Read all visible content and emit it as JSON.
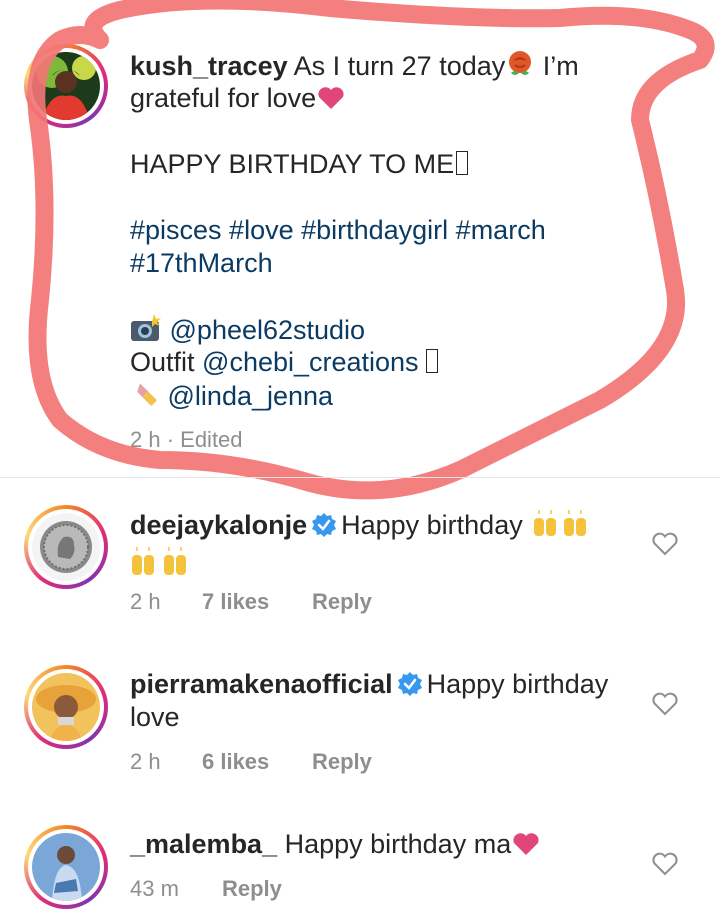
{
  "post": {
    "username": "kush_tracey",
    "caption_line1": " As I turn 27 today",
    "caption_line1_end": " I’m",
    "caption_line2": "grateful for love",
    "birthday_line": "HAPPY BIRTHDAY TO ME",
    "hashtags_line1": "#pisces #love #birthdaygirl #march",
    "hashtags_line2": "#17thMarch",
    "photo_credit": "@pheel62studio",
    "outfit_label": "Outfit ",
    "outfit_credit": "@chebi_creations",
    "makeup_credit": "@linda_jenna",
    "time": "2 h",
    "edited": " · Edited"
  },
  "comments": [
    {
      "username": "deejaykalonje",
      "verified": true,
      "text": "Happy birthday",
      "time": "2 h",
      "likes": "7 likes",
      "reply": "Reply",
      "avatar_icon": "coin-avatar-icon"
    },
    {
      "username": "pierramakenaofficial",
      "verified": true,
      "text": "Happy birthday",
      "text_line2": "love",
      "time": "2 h",
      "likes": "6 likes",
      "reply": "Reply",
      "avatar_icon": "hat-avatar-icon"
    },
    {
      "username": "_malemba_",
      "verified": false,
      "text": " Happy birthday ma",
      "time": "43 m",
      "reply": "Reply",
      "avatar_icon": "portrait-avatar-icon"
    }
  ],
  "colors": {
    "username": "#262626",
    "link": "#0b3b63",
    "meta": "#8e8e8e",
    "verified": "#3897f0",
    "heart": "#e0457b",
    "annotation": "#f27474"
  }
}
